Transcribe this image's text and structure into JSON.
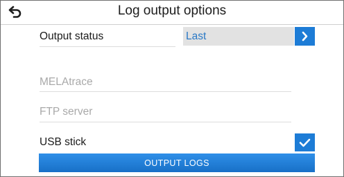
{
  "header": {
    "title": "Log output options",
    "back_icon": "back-arrow-icon"
  },
  "rows": {
    "output_status_label": "Output status",
    "output_status_value": "Last",
    "melatrace_label": "MELAtrace",
    "ftp_label": "FTP server",
    "usb_label": "USB stick",
    "usb_checked": true
  },
  "actions": {
    "output_logs_label": "OUTPUT LOGS"
  },
  "colors": {
    "accent": "#1d7cd6",
    "value_text": "#2a79c6",
    "value_bg": "#e2e2e2",
    "disabled_text": "#a9a9a9"
  }
}
